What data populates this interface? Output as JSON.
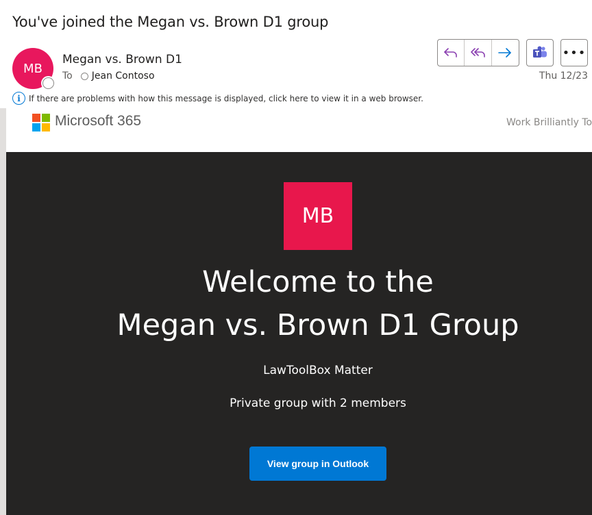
{
  "subject": "You've joined the Megan vs. Brown D1 group",
  "sender": {
    "initials": "MB",
    "name": "Megan vs. Brown D1",
    "avatar_color": "#e8175d"
  },
  "recipients": {
    "label": "To",
    "items": [
      "Jean Contoso"
    ]
  },
  "date": "Thu 12/23",
  "actions": {
    "icons": [
      "reply-icon",
      "reply-all-icon",
      "forward-icon",
      "teams-icon",
      "more-icon"
    ],
    "more_label": "•••"
  },
  "info_bar": {
    "icon": "info-icon",
    "glyph": "i",
    "text": "If there are problems with how this message is displayed, click here to view it in a web browser."
  },
  "email_body": {
    "brand": "Microsoft 365",
    "tagline": "Work Brilliantly Toge",
    "group_initials": "MB",
    "group_tile_color": "#e8174c",
    "welcome_line1": "Welcome to the",
    "welcome_line2": "Megan vs. Brown D1 Group",
    "subtitle": "LawToolBox Matter",
    "members_text": "Private group with 2 members",
    "cta_label": "View group in Outlook",
    "cta_color": "#0078d4",
    "panel_color": "#252423"
  }
}
